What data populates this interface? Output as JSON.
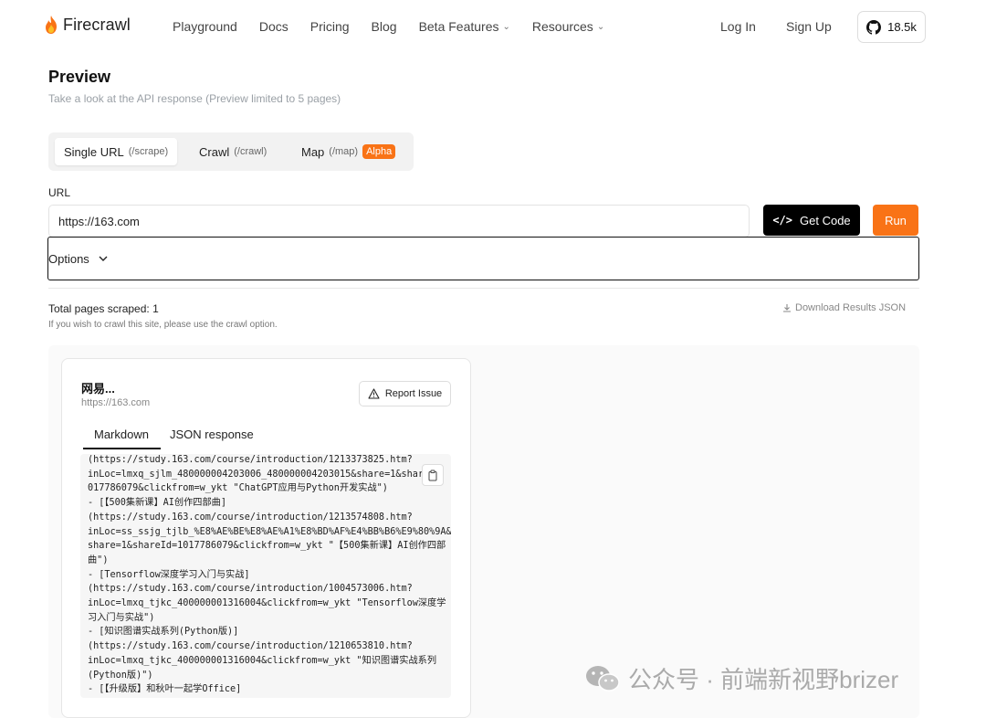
{
  "nav": {
    "brand": "Firecrawl",
    "links": [
      {
        "label": "Playground"
      },
      {
        "label": "Docs"
      },
      {
        "label": "Pricing"
      },
      {
        "label": "Blog"
      },
      {
        "label": "Beta Features",
        "dropdown": true
      },
      {
        "label": "Resources",
        "dropdown": true
      }
    ],
    "login": "Log In",
    "signup": "Sign Up",
    "github_stars": "18.5k"
  },
  "preview": {
    "title": "Preview",
    "subtitle": "Take a look at the API response (Preview limited to 5 pages)"
  },
  "mode_tabs": [
    {
      "label": "Single URL",
      "hint": "(/scrape)",
      "active": true
    },
    {
      "label": "Crawl",
      "hint": "(/crawl)",
      "active": false
    },
    {
      "label": "Map",
      "hint": "(/map)",
      "badge": "Alpha",
      "active": false
    }
  ],
  "url_form": {
    "label": "URL",
    "value": "https://163.com",
    "get_code_label": "Get Code",
    "run_label": "Run",
    "options_label": "Options"
  },
  "results": {
    "total": "Total pages scraped: 1",
    "hint": "If you wish to crawl this site, please use the crawl option.",
    "download_label": "Download Results JSON"
  },
  "card": {
    "title": "网易...",
    "url": "https://163.com",
    "report_label": "Report Issue",
    "tabs": [
      "Markdown",
      "JSON response"
    ],
    "markdown_lines": [
      "(https://study.163.com/course/introduction/1213373825.htm?",
      "inLoc=lmxq_sjlm_480000004203006_480000004203015&share=1&share",
      "017786079&clickfrom=w_ykt \"ChatGPT应用与Python开发实战\")",
      "- [【500集新课】AI创作四部曲]",
      "(https://study.163.com/course/introduction/1213574808.htm?",
      "inLoc=ss_ssjg_tjlb_%E8%AE%BE%E8%AE%A1%E8%BD%AF%E4%BB%B6%E9%80%9A&",
      "share=1&shareId=1017786079&clickfrom=w_ykt \"【500集新课】AI创作四部",
      "曲\")",
      "- [Tensorflow深度学习入门与实战]",
      "(https://study.163.com/course/introduction/1004573006.htm?",
      "inLoc=lmxq_tjkc_400000001316004&clickfrom=w_ykt \"Tensorflow深度学",
      "习入门与实战\")",
      "- [知识图谱实战系列(Python版)]",
      "(https://study.163.com/course/introduction/1210653810.htm?",
      "inLoc=lmxq_tjkc_400000001316004&clickfrom=w_ykt \"知识图谱实战系列",
      "(Python版)\")",
      "- [【升级版】和秋叶一起学Office]"
    ]
  },
  "watermark": "公众号 · 前端新视野brizer",
  "colors": {
    "accent": "#f97316",
    "dark_button": "#000000"
  }
}
